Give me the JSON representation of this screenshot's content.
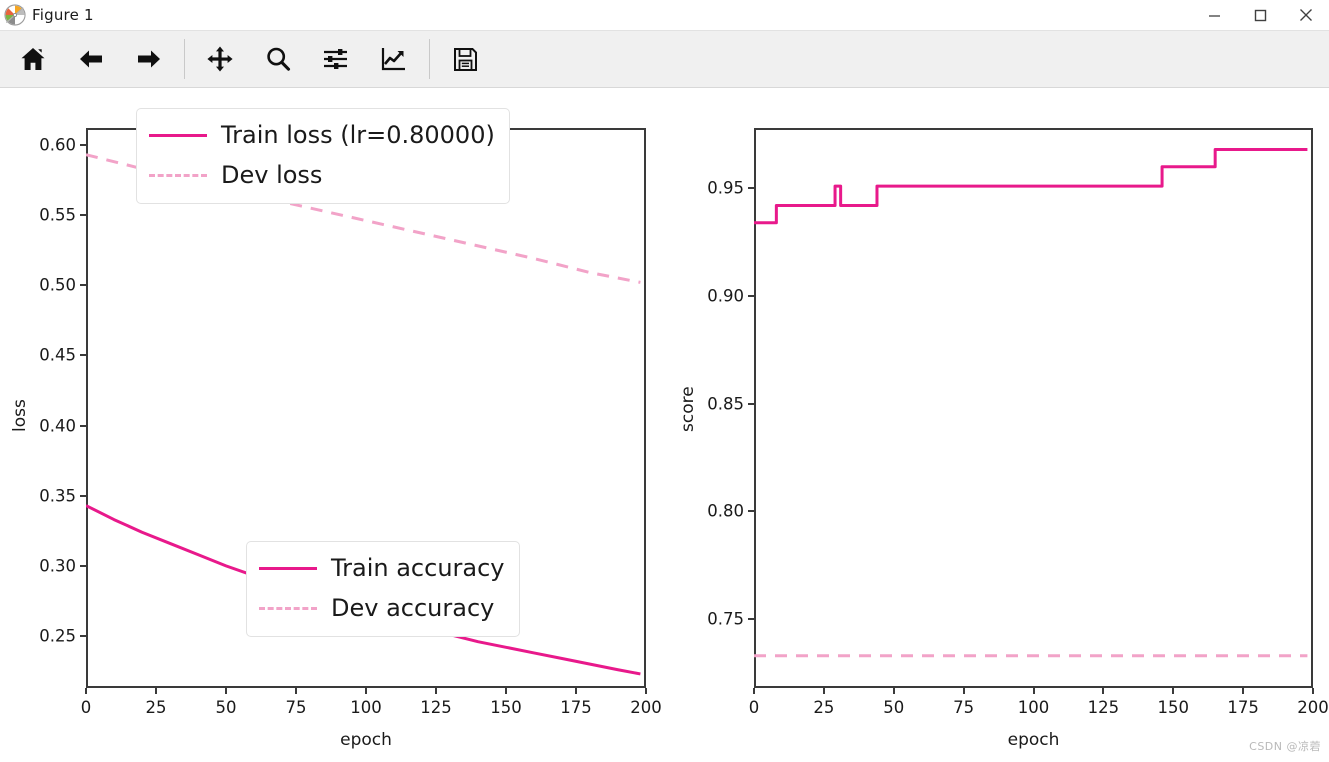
{
  "window": {
    "title": "Figure 1",
    "app_icon": "matplotlib-logo-icon",
    "controls": {
      "minimize": "─",
      "maximize": "□",
      "close": "✕"
    }
  },
  "toolbar": {
    "buttons": [
      {
        "name": "home-icon",
        "tooltip": "Home"
      },
      {
        "name": "back-arrow-icon",
        "tooltip": "Back"
      },
      {
        "name": "forward-arrow-icon",
        "tooltip": "Forward"
      },
      {
        "name": "pan-move-icon",
        "tooltip": "Pan"
      },
      {
        "name": "zoom-magnifier-icon",
        "tooltip": "Zoom to rectangle"
      },
      {
        "name": "configure-subplots-sliders-icon",
        "tooltip": "Configure subplots"
      },
      {
        "name": "edit-axis-curve-chart-icon",
        "tooltip": "Edit axis, curve and image parameters"
      },
      {
        "name": "save-floppy-disk-icon",
        "tooltip": "Save the figure"
      }
    ]
  },
  "watermark": "CSDN @凉菪",
  "chart_data": [
    {
      "type": "line",
      "id": "loss-plot",
      "title": "",
      "xlabel": "epoch",
      "ylabel": "loss",
      "xlim": [
        0,
        200
      ],
      "ylim": [
        0.213,
        0.612
      ],
      "xticks": [
        0,
        25,
        50,
        75,
        100,
        125,
        150,
        175,
        200
      ],
      "xticklabels": [
        "0",
        "25",
        "50",
        "75",
        "100",
        "125",
        "150",
        "175",
        "200"
      ],
      "yticks": [
        0.25,
        0.3,
        0.35,
        0.4,
        0.45,
        0.5,
        0.55,
        0.6
      ],
      "yticklabels": [
        "0.25",
        "0.30",
        "0.35",
        "0.40",
        "0.45",
        "0.50",
        "0.55",
        "0.60"
      ],
      "grid": false,
      "legend_position": "upper right",
      "series": [
        {
          "name": "Train loss (lr=0.80000)",
          "style": "solid",
          "color": "#e8198b",
          "x": [
            0,
            10,
            20,
            30,
            40,
            50,
            60,
            70,
            80,
            90,
            100,
            110,
            120,
            130,
            140,
            150,
            160,
            170,
            180,
            190,
            198
          ],
          "y": [
            0.343,
            0.333,
            0.324,
            0.316,
            0.308,
            0.3,
            0.293,
            0.286,
            0.28,
            0.274,
            0.268,
            0.262,
            0.256,
            0.251,
            0.246,
            0.242,
            0.238,
            0.234,
            0.23,
            0.226,
            0.223
          ]
        },
        {
          "name": "Dev loss",
          "style": "dashed",
          "color": "#f2a3c8",
          "x": [
            0,
            20,
            40,
            60,
            80,
            100,
            120,
            140,
            160,
            180,
            198
          ],
          "y": [
            0.593,
            0.583,
            0.573,
            0.564,
            0.555,
            0.546,
            0.537,
            0.528,
            0.519,
            0.509,
            0.502
          ]
        }
      ]
    },
    {
      "type": "line",
      "id": "accuracy-plot",
      "title": "",
      "xlabel": "epoch",
      "ylabel": "score",
      "xlim": [
        0,
        200
      ],
      "ylim": [
        0.718,
        0.978
      ],
      "xticks": [
        0,
        25,
        50,
        75,
        100,
        125,
        150,
        175,
        200
      ],
      "xticklabels": [
        "0",
        "25",
        "50",
        "75",
        "100",
        "125",
        "150",
        "175",
        "200"
      ],
      "yticks": [
        0.75,
        0.8,
        0.85,
        0.9,
        0.95
      ],
      "yticklabels": [
        "0.75",
        "0.80",
        "0.85",
        "0.90",
        "0.95"
      ],
      "grid": false,
      "legend_position": "lower right",
      "series": [
        {
          "name": "Train accuracy",
          "style": "solid-step",
          "color": "#e8198b",
          "x": [
            0,
            8,
            8,
            29,
            29,
            31,
            31,
            44,
            44,
            146,
            146,
            165,
            165,
            198
          ],
          "y": [
            0.934,
            0.934,
            0.942,
            0.942,
            0.951,
            0.951,
            0.942,
            0.942,
            0.951,
            0.951,
            0.96,
            0.96,
            0.968,
            0.968
          ]
        },
        {
          "name": "Dev accuracy",
          "style": "dashed",
          "color": "#f2a3c8",
          "x": [
            0,
            198
          ],
          "y": [
            0.733,
            0.733
          ]
        }
      ]
    }
  ]
}
